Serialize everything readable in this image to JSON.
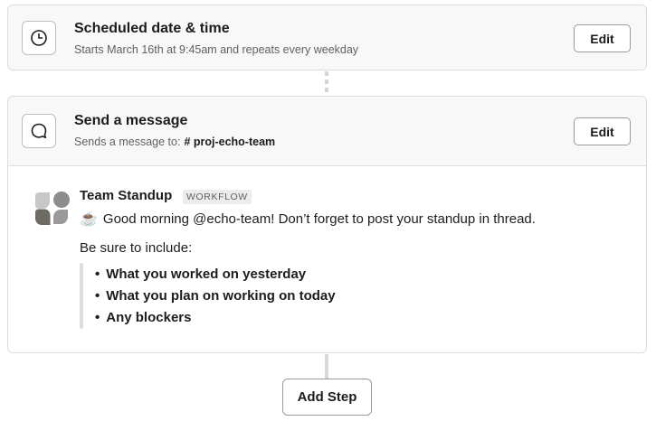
{
  "steps": [
    {
      "icon": "clock-icon",
      "title": "Scheduled date & time",
      "subtitle": "Starts March 16th at 9:45am and repeats every weekday",
      "edit_label": "Edit"
    },
    {
      "icon": "message-bubble-icon",
      "title": "Send a message",
      "subtitle_prefix": "Sends a message to:",
      "channel": "# proj-echo-team",
      "edit_label": "Edit"
    }
  ],
  "message_preview": {
    "sender": "Team Standup",
    "badge": "WORKFLOW",
    "emoji": "☕",
    "text": "Good morning @echo-team! Don’t forget to post your standup in thread.",
    "include_label": "Be sure to include:",
    "items": [
      "What you worked on yesterday",
      "What you plan on working on today",
      "Any blockers"
    ]
  },
  "add_step_label": "Add Step",
  "colors": {
    "card_background": "#f8f8f8",
    "border": "#dddddd",
    "text_primary": "#1d1c1d",
    "text_secondary": "#616061"
  }
}
